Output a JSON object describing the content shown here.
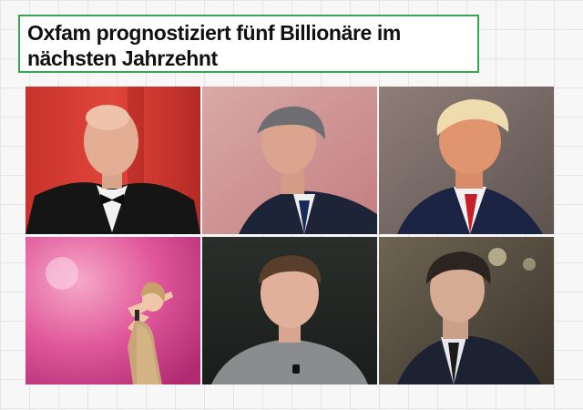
{
  "headline": {
    "text": "Oxfam prognostiziert fünf Billionäre im nächsten Jahrzehnt",
    "border_color": "#3aa655"
  },
  "photos": [
    {
      "subject": "Bald man in black tuxedo with bow tie, red background"
    },
    {
      "subject": "Older man in profile, dark suit and tie, pink backdrop"
    },
    {
      "subject": "Man with blond hair, navy suit, red tie"
    },
    {
      "subject": "Singer on stage in sequined outfit with microphone, pink light"
    },
    {
      "subject": "Young man in grey sweater, dark background"
    },
    {
      "subject": "Man in dark suit and tie, serious expression"
    }
  ]
}
